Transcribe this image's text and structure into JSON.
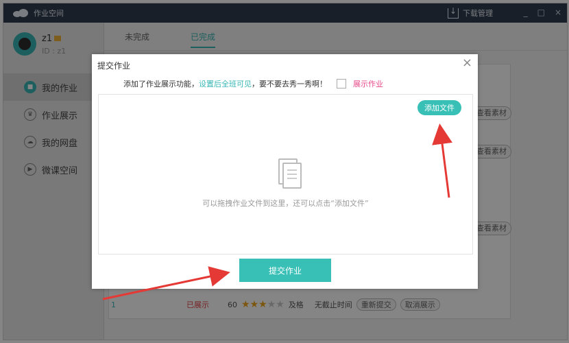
{
  "app": {
    "title": "作业空间",
    "download_label": "下载管理",
    "window_buttons": [
      "_",
      "□",
      "×"
    ]
  },
  "user": {
    "name": "z1",
    "id": "ID : z1"
  },
  "sidebar": {
    "items": [
      {
        "label": "我的作业",
        "active": true
      },
      {
        "label": "作业展示",
        "active": false
      },
      {
        "label": "我的网盘",
        "active": false
      },
      {
        "label": "微课空间",
        "active": false
      }
    ]
  },
  "tabs": [
    {
      "label": "未完成",
      "active": false
    },
    {
      "label": "已完成",
      "active": true
    }
  ],
  "background_table": {
    "side_buttons": [
      "查看素材",
      "查看素材",
      "查看素材"
    ],
    "row": {
      "index": "1",
      "status": "已展示",
      "score": "60",
      "stars_filled": 3,
      "stars_total": 5,
      "grade": "及格",
      "deadline": "无截止时间",
      "btn_resubmit": "重新提交",
      "btn_cancel": "取消展示"
    }
  },
  "modal": {
    "title": "提交作业",
    "close": "×",
    "notice_prefix": "添加了作业展示功能，",
    "notice_link": "设置后全班可见",
    "notice_suffix": "，要不要去秀一秀啊！",
    "show_checkbox_label": "展示作业",
    "add_file_button": "添加文件",
    "drop_hint": "可以拖拽作业文件到这里，还可以点击“添加文件”",
    "submit_button": "提交作业"
  },
  "colors": {
    "accent": "#38c0b7",
    "titlebar": "#2f3d50",
    "annotation_arrow": "#e53935"
  }
}
